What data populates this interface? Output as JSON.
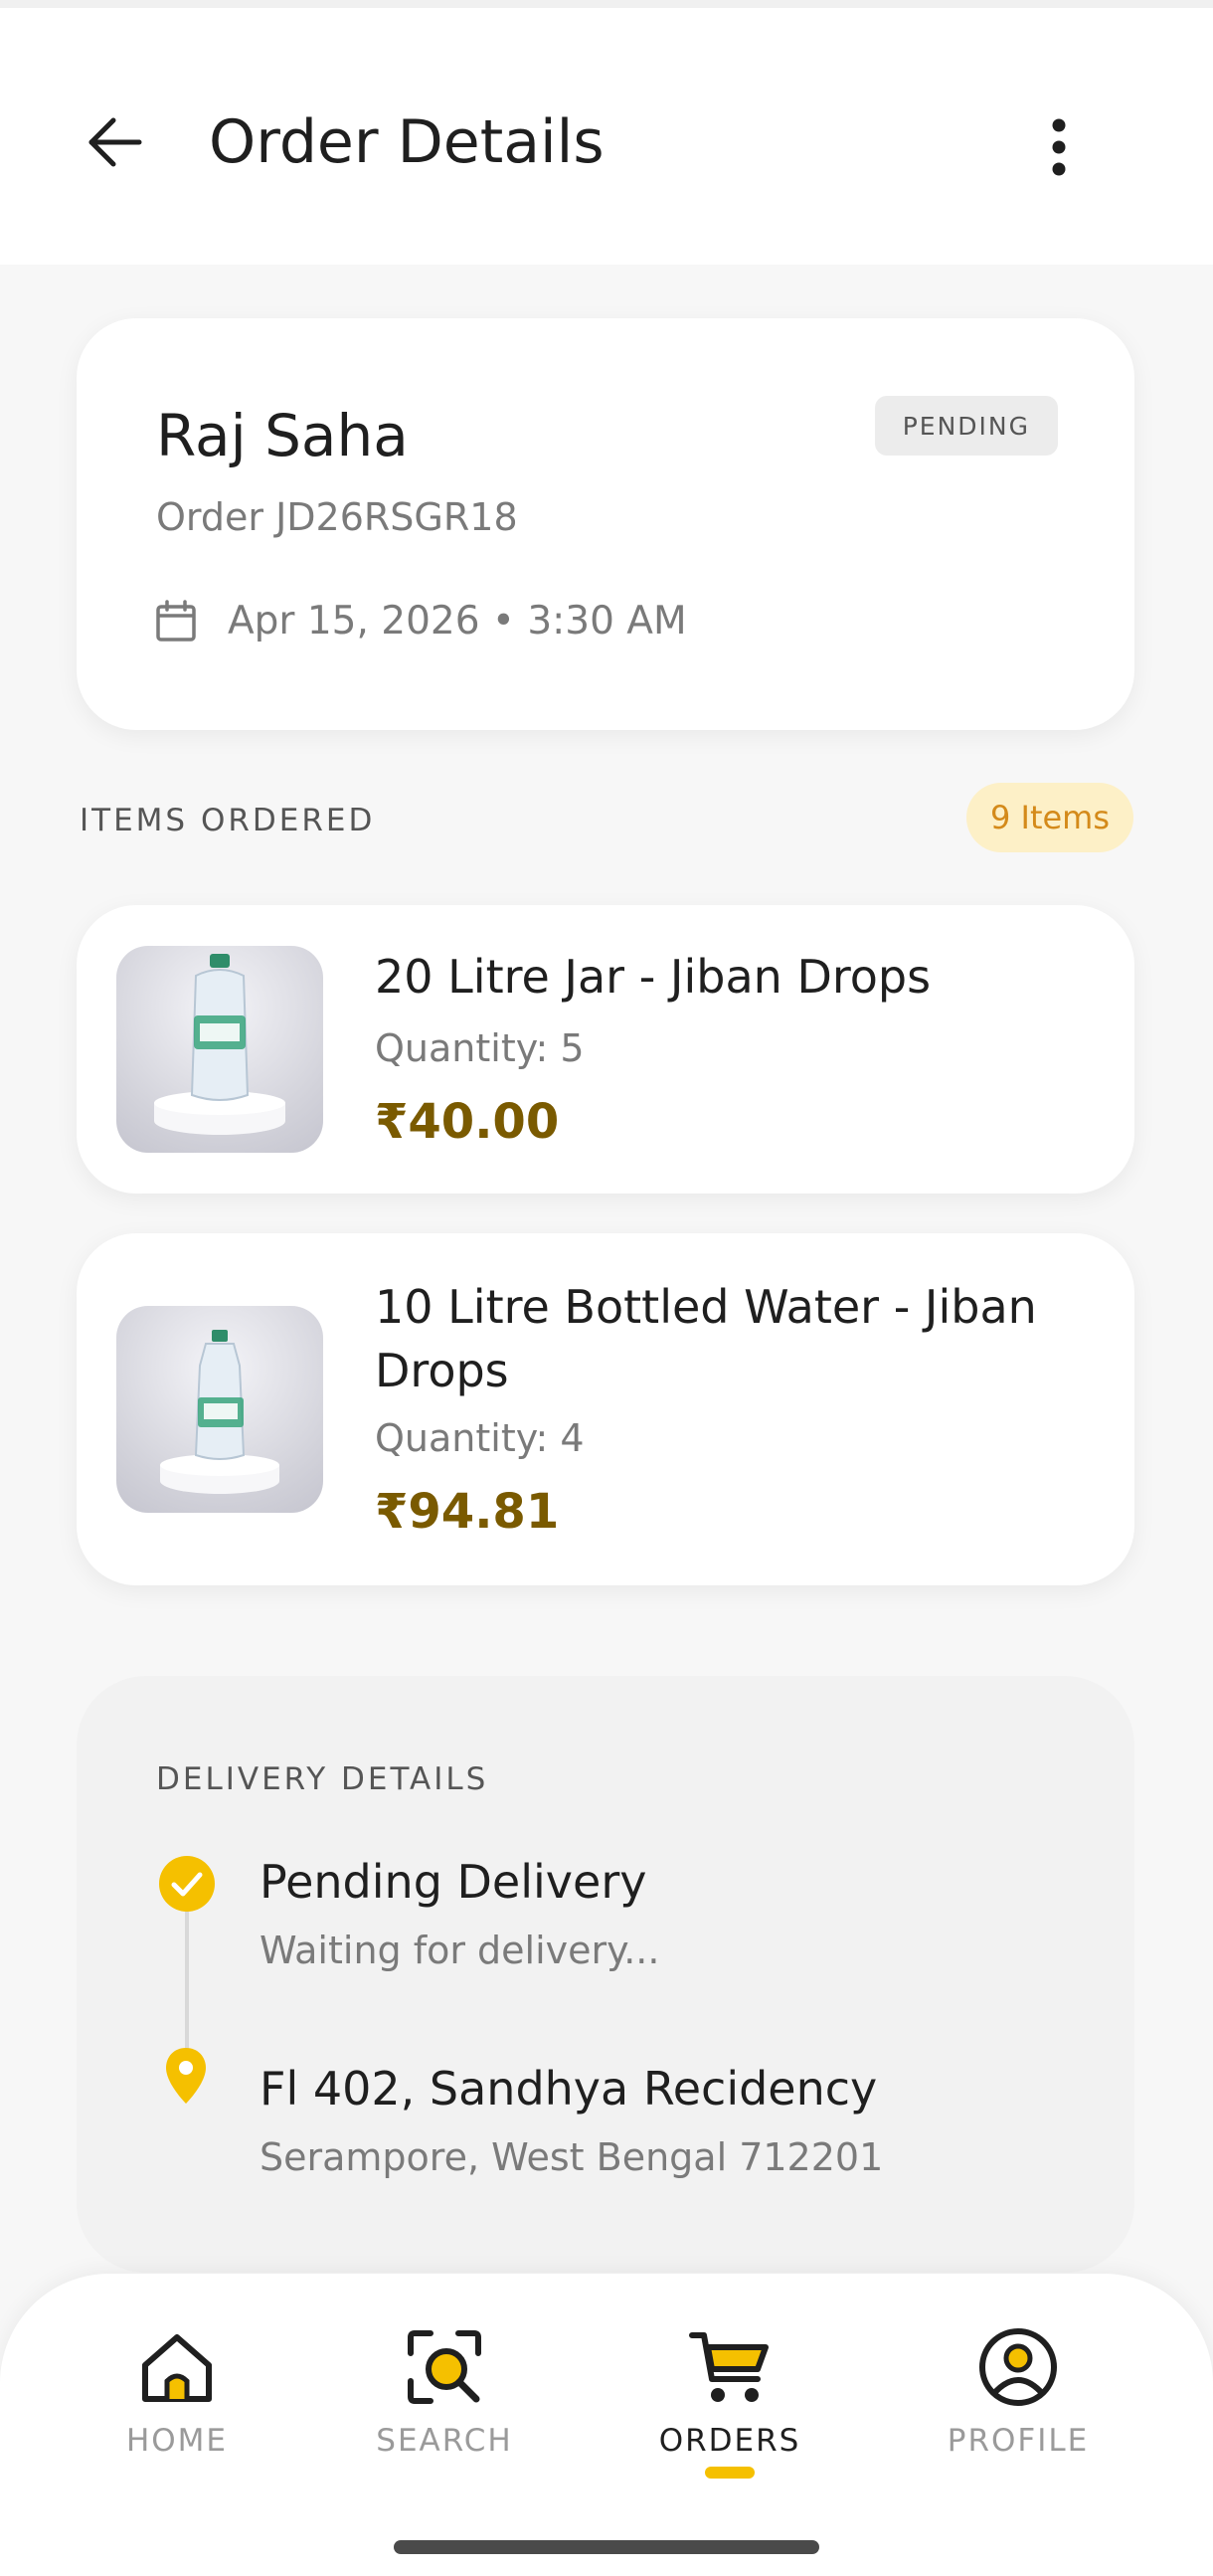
{
  "app_bar": {
    "title": "Order Details",
    "back_icon": "arrow-left-icon",
    "menu_icon": "more-vert-icon"
  },
  "customer": {
    "name": "Raj Saha",
    "order_id": "Order JD26RSGR18",
    "status": "PENDING",
    "date_icon": "calendar-icon",
    "date_time": "Apr 15, 2026 • 3:30 AM"
  },
  "items_section": {
    "label": "ITEMS ORDERED",
    "count": "9 Items",
    "items": [
      {
        "name": "20 Litre Jar - Jiban Drops",
        "quantity": "Quantity: 5",
        "price": "₹40.00"
      },
      {
        "name": "10 Litre Bottled Water - Jiban Drops",
        "quantity": "Quantity: 4",
        "price": "₹94.81"
      }
    ]
  },
  "delivery": {
    "label": "DELIVERY DETAILS",
    "status_title": "Pending Delivery",
    "status_sub": "Waiting for delivery...",
    "address_line1": "Fl 402, Sandhya Recidency",
    "address_line2": "Serampore, West Bengal 712201"
  },
  "nav": {
    "home": "HOME",
    "search": "SEARCH",
    "orders": "ORDERS",
    "profile": "PROFILE",
    "active": "ORDERS"
  },
  "colors": {
    "accent": "#f5c000",
    "price": "#7a5a00",
    "badge_bg": "#fdf0c7",
    "badge_text": "#d48a1a"
  }
}
